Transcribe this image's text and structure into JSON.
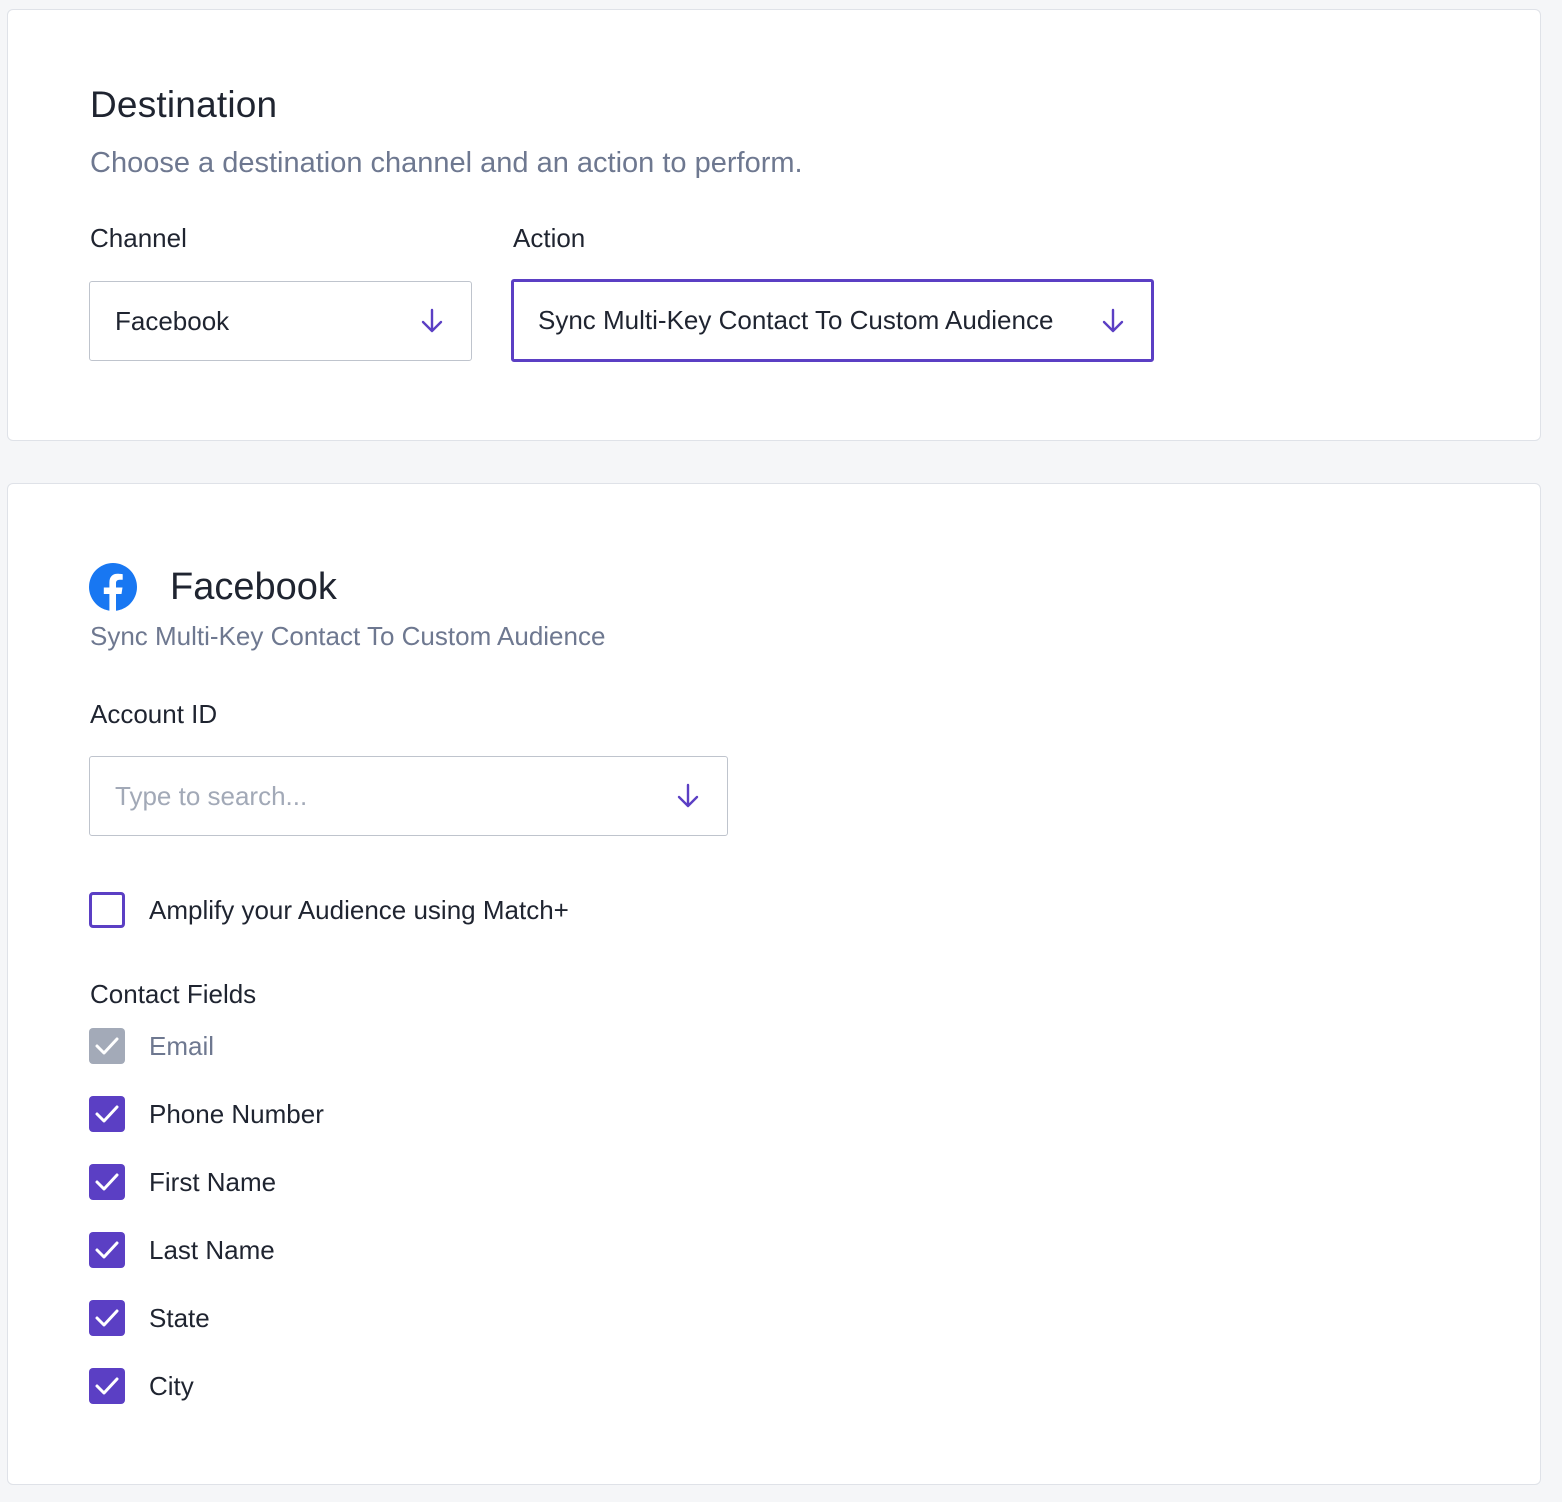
{
  "destination": {
    "title": "Destination",
    "subtitle": "Choose a destination channel and an action to perform.",
    "channel_label": "Channel",
    "channel_value": "Facebook",
    "action_label": "Action",
    "action_value": "Sync Multi-Key Contact To Custom Audience"
  },
  "facebook": {
    "name": "Facebook",
    "subtitle": "Sync Multi-Key Contact To Custom Audience",
    "account_label": "Account ID",
    "account_placeholder": "Type to search...",
    "match_plus": {
      "label": "Amplify your Audience using Match+",
      "checked": false
    },
    "contact_fields_label": "Contact Fields",
    "contact_fields": [
      {
        "label": "Email",
        "checked": true,
        "disabled": true
      },
      {
        "label": "Phone Number",
        "checked": true,
        "disabled": false
      },
      {
        "label": "First Name",
        "checked": true,
        "disabled": false
      },
      {
        "label": "Last Name",
        "checked": true,
        "disabled": false
      },
      {
        "label": "State",
        "checked": true,
        "disabled": false
      },
      {
        "label": "City",
        "checked": true,
        "disabled": false
      }
    ]
  },
  "icons": {
    "dropdown": "arrow-down-icon",
    "brand": "facebook-logo-icon",
    "check": "check-icon"
  },
  "colors": {
    "accent": "#5b3fc4",
    "disabled_check": "#a3aab8",
    "facebook_blue": "#1877f2",
    "muted_text": "#6e7890"
  }
}
